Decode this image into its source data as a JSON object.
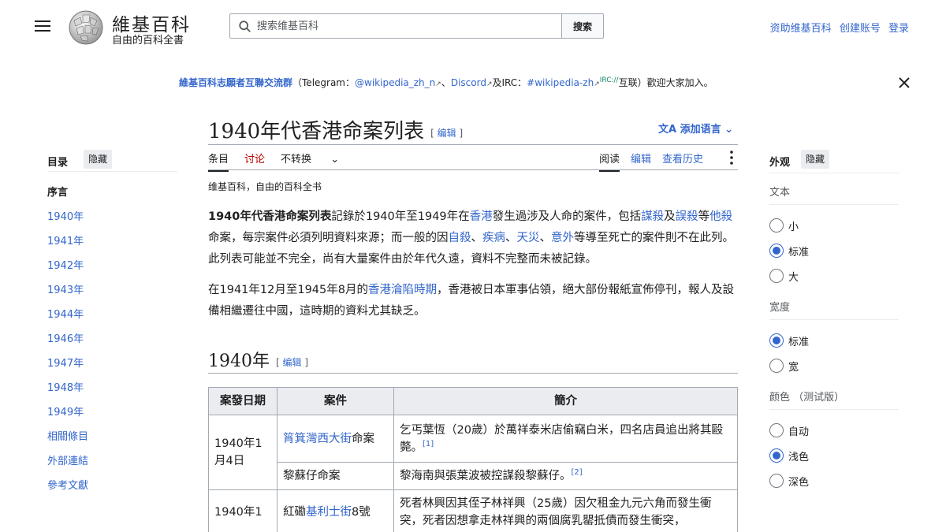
{
  "header": {
    "site_name": "維基百科",
    "tagline": "自由的百科全書",
    "search_placeholder": "搜索维基百科",
    "search_button": "搜索",
    "user_links": [
      "资助维基百科",
      "创建账号",
      "登录"
    ]
  },
  "banner": {
    "link": "維基百科志願者互聯交流群",
    "open": "（Telegram：",
    "telegram": "@wikipedia_zh_n",
    "sep1": "、",
    "discord": "Discord",
    "irc_prefix": "及IRC：",
    "irc": "#wikipedia-zh",
    "irc_sup": "IRC://",
    "close_text": "互联）歡迎大家加入。"
  },
  "toc": {
    "title": "目录",
    "hide": "隐藏",
    "items": [
      "序言",
      "1940年",
      "1941年",
      "1942年",
      "1943年",
      "1944年",
      "1946年",
      "1947年",
      "1948年",
      "1949年",
      "相關條目",
      "外部連結",
      "參考文獻"
    ]
  },
  "page": {
    "title": "1940年代香港命案列表",
    "edit_label": "编辑",
    "add_languages": "添加语言",
    "tabs_left": [
      "条目",
      "讨论",
      "不转换"
    ],
    "tabs_right": [
      "阅读",
      "编辑",
      "查看历史"
    ],
    "site_tagline": "维基百科，自由的百科全书"
  },
  "content": {
    "p1": {
      "bold": "1940年代香港命案列表",
      "t1": "記錄於1940年至1949年在",
      "l1": "香港",
      "t2": "發生過涉及人命的案件，包括",
      "l2": "謀殺",
      "t3": "及",
      "l3": "誤殺",
      "t4": "等",
      "l4": "他殺",
      "t5": "命案，每宗案件必須列明資料來源；而一般的因",
      "l5": "自殺",
      "t6": "、",
      "l6": "疾病",
      "t7": "、",
      "l7": "天災",
      "t8": "、",
      "l8": "意外",
      "t9": "等導至死亡的案件則不在此列。此列表可能並不完全，尚有大量案件由於年代久遠，資料不完整而未被記錄。"
    },
    "p2": {
      "t1": "在1941年12月至1945年8月的",
      "l1": "香港淪陷時期",
      "t2": "，香港被日本軍事佔領，絕大部份報紙宣佈停刊，報人及設備相繼遷往中國，這時期的資料尤其缺乏。"
    },
    "section_title": "1940年",
    "table": {
      "headers": [
        "案發日期",
        "案件",
        "簡介"
      ],
      "rows": [
        {
          "date": "1940年1月4日",
          "case_link": "筲箕灣西大街",
          "case_suffix": "命案",
          "summary": "乞丐葉恆（20歲）於萬祥泰米店偷竊白米，四名店員追出將其毆斃。",
          "ref": "[1]"
        },
        {
          "case_text": "黎蘇仔命案",
          "summary": "黎海南與張葉波被控謀殺黎蘇仔。",
          "ref": "[2]"
        },
        {
          "date": "1940年1",
          "case_prefix": "紅磡",
          "case_link": "基利士街",
          "case_suffix": "8號",
          "summary": "死者林興因其侄子林祥興（25歲）因欠租金九元六角而發生衝突，死者因想拿走林祥興的兩個腐乳罌抵債而發生衝突，"
        }
      ]
    }
  },
  "appearance": {
    "title": "外观",
    "hide": "隐藏",
    "text_label": "文本",
    "text_options": [
      "小",
      "标准",
      "大"
    ],
    "text_selected": "标准",
    "width_label": "宽度",
    "width_options": [
      "标准",
      "宽"
    ],
    "width_selected": "标准",
    "color_label": "颜色 （测试版）",
    "color_options": [
      "自动",
      "浅色",
      "深色"
    ],
    "color_selected": "浅色"
  }
}
